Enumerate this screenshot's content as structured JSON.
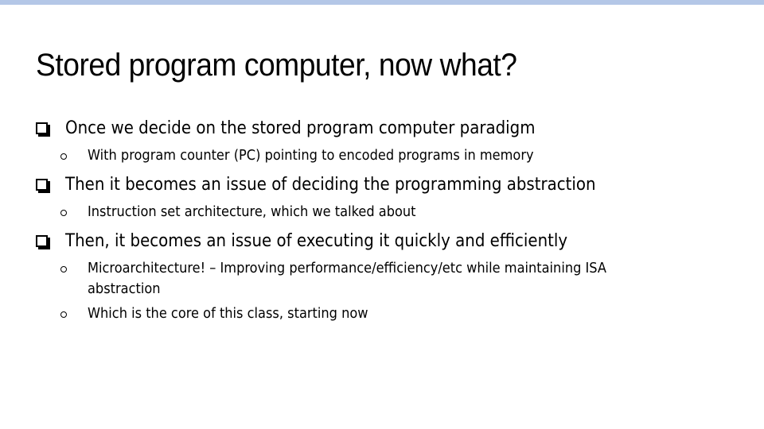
{
  "slide": {
    "accent_color": "#b4c7e7",
    "title": "Stored program computer, now what?",
    "bullets": [
      {
        "text": "Once we decide on the stored program computer paradigm",
        "subs": [
          "With program counter (PC) pointing to encoded programs in memory"
        ]
      },
      {
        "text": "Then it becomes an issue of deciding the programming abstraction",
        "subs": [
          "Instruction set architecture, which we talked about"
        ]
      },
      {
        "text": "Then, it becomes an issue of executing it quickly and efficiently",
        "subs": [
          "Microarchitecture! – Improving performance/efficiency/etc while maintaining ISA",
          "abstraction",
          "Which is the core of this class, starting now"
        ]
      }
    ],
    "bullet_icon": "square-shadow-bullet",
    "sub_bullet_icon": "hollow-circle-bullet"
  }
}
